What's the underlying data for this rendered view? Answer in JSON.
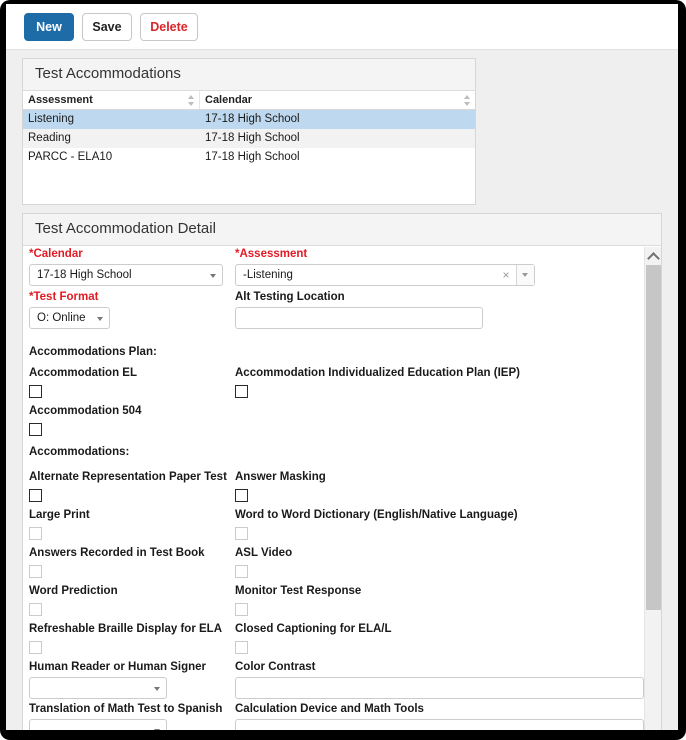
{
  "toolbar": {
    "new_label": "New",
    "save_label": "Save",
    "delete_label": "Delete"
  },
  "list_panel": {
    "title": "Test Accommodations",
    "columns": [
      "Assessment",
      "Calendar"
    ],
    "rows": [
      {
        "assessment": "Listening",
        "calendar": "17-18 High School",
        "selected": true
      },
      {
        "assessment": "Reading",
        "calendar": "17-18 High School",
        "selected": false
      },
      {
        "assessment": "PARCC - ELA10",
        "calendar": "17-18 High School",
        "selected": false
      }
    ]
  },
  "detail_panel": {
    "title": "Test Accommodation Detail",
    "fields": {
      "calendar": {
        "label": "*Calendar",
        "value": "17-18 High School"
      },
      "assessment": {
        "label": "*Assessment",
        "value": "-Listening",
        "clear_icon": "×"
      },
      "test_format": {
        "label": "*Test Format",
        "value": "O: Online"
      },
      "alt_testing_location": {
        "label": "Alt Testing Location",
        "value": ""
      }
    },
    "plan_section": {
      "heading": "Accommodations Plan:",
      "items": [
        {
          "label": "Accommodation EL",
          "disabled": false
        },
        {
          "label": "Accommodation Individualized Education Plan (IEP)",
          "disabled": false
        },
        {
          "label": "Accommodation 504",
          "disabled": false
        }
      ]
    },
    "accommodations_section": {
      "heading": "Accommodations:",
      "rows": [
        {
          "left": {
            "label": "Alternate Representation Paper Test",
            "control": "checkbox",
            "disabled": false
          },
          "right": {
            "label": "Answer Masking",
            "control": "checkbox",
            "disabled": false
          }
        },
        {
          "left": {
            "label": "Large Print",
            "control": "checkbox",
            "disabled": true
          },
          "right": {
            "label": "Word to Word Dictionary (English/Native Language)",
            "control": "checkbox",
            "disabled": true
          }
        },
        {
          "left": {
            "label": "Answers Recorded in Test Book",
            "control": "checkbox",
            "disabled": true
          },
          "right": {
            "label": "ASL Video",
            "control": "checkbox",
            "disabled": true
          }
        },
        {
          "left": {
            "label": "Word Prediction",
            "control": "checkbox",
            "disabled": true
          },
          "right": {
            "label": "Monitor Test Response",
            "control": "checkbox",
            "disabled": true
          }
        },
        {
          "left": {
            "label": "Refreshable Braille Display for ELA",
            "control": "checkbox",
            "disabled": true
          },
          "right": {
            "label": "Closed Captioning for ELA/L",
            "control": "checkbox",
            "disabled": true
          }
        },
        {
          "left": {
            "label": "Human Reader or Human Signer",
            "control": "select",
            "value": ""
          },
          "right": {
            "label": "Color Contrast",
            "control": "text",
            "value": ""
          }
        },
        {
          "left": {
            "label": "Translation of Math Test to Spanish",
            "control": "select",
            "value": ""
          },
          "right": {
            "label": "Calculation Device and Math Tools",
            "control": "text",
            "value": ""
          }
        }
      ]
    }
  },
  "scrollbar": {
    "up_icon": "chevron-up-icon"
  },
  "colors": {
    "primary_button": "#1d6ca8",
    "delete_text": "#d8262c",
    "required_label": "#e01b24",
    "selected_row": "#bed9ef"
  }
}
